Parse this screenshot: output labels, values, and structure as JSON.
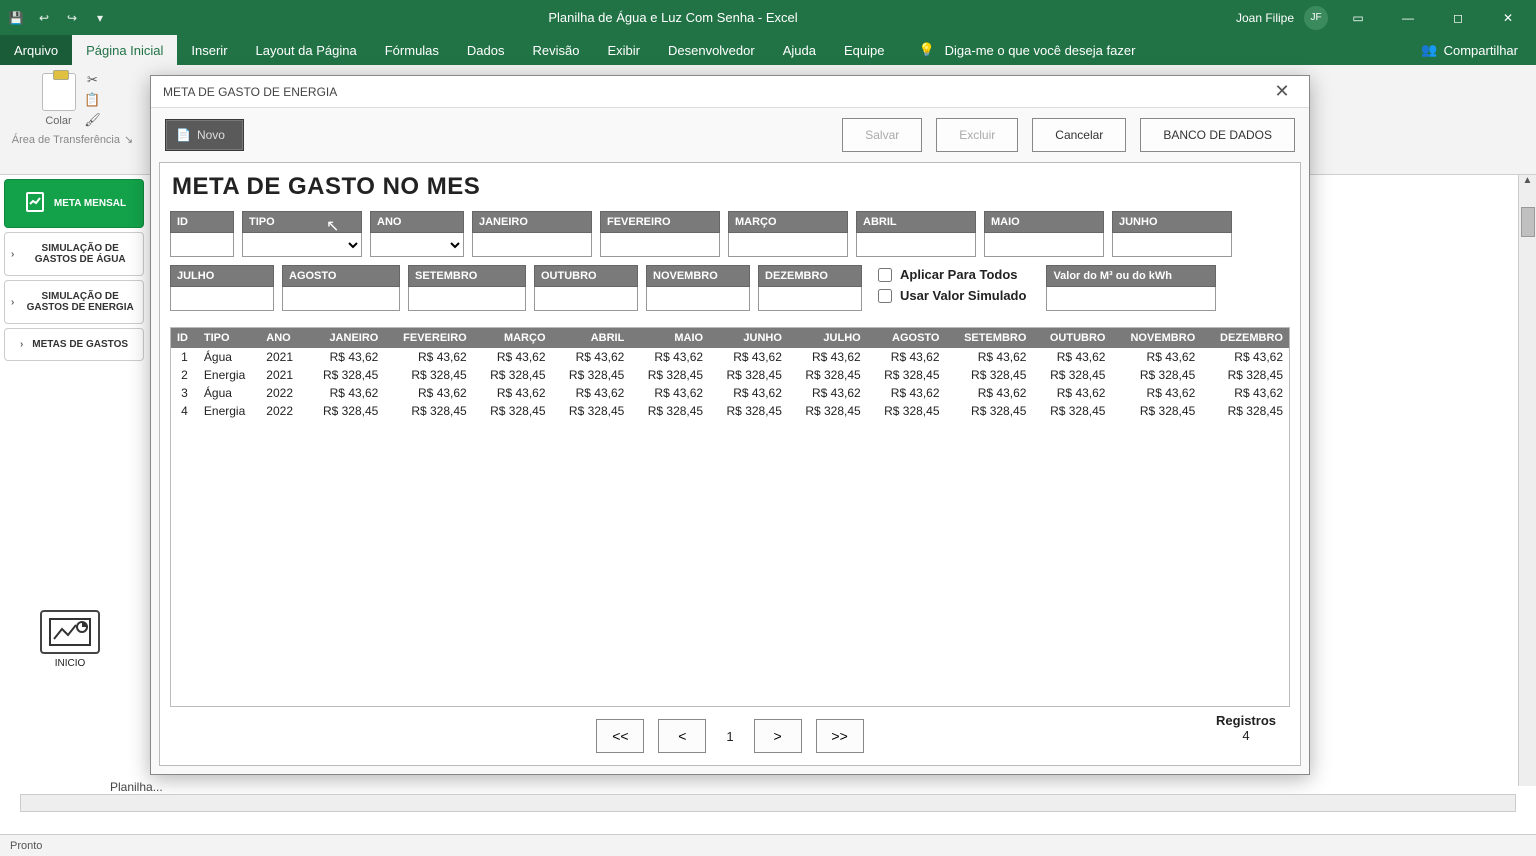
{
  "titlebar": {
    "doc_title": "Planilha de Água e Luz Com Senha  -  Excel",
    "user_name": "Joan Filipe",
    "user_initials": "JF"
  },
  "ribbon": {
    "tabs": [
      "Arquivo",
      "Página Inicial",
      "Inserir",
      "Layout da Página",
      "Fórmulas",
      "Dados",
      "Revisão",
      "Exibir",
      "Desenvolvedor",
      "Ajuda",
      "Equipe"
    ],
    "tell_me": "Diga-me o que você deseja fazer",
    "share": "Compartilhar",
    "paste_label": "Colar",
    "clipboard_group": "Área de Transferência"
  },
  "sidebar": {
    "meta_mensal": "META MENSAL",
    "sim_agua": "SIMULAÇÃO DE GASTOS DE ÁGUA",
    "sim_energia": "SIMULAÇÃO DE GASTOS DE ENERGIA",
    "metas": "METAS DE GASTOS",
    "inicio": "INICIO"
  },
  "dialog": {
    "title": "META DE GASTO DE ENERGIA",
    "novo": "Novo",
    "salvar": "Salvar",
    "excluir": "Excluir",
    "cancelar": "Cancelar",
    "banco": "BANCO DE DADOS",
    "heading": "META DE GASTO NO MES",
    "fields": {
      "id": "ID",
      "tipo": "TIPO",
      "ano": "ANO",
      "jan": "JANEIRO",
      "fev": "FEVEREIRO",
      "mar": "MARÇO",
      "abr": "ABRIL",
      "mai": "MAIO",
      "jun": "JUNHO",
      "jul": "JULHO",
      "ago": "AGOSTO",
      "set": "SETEMBRO",
      "out": "OUTUBRO",
      "nov": "NOVEMBRO",
      "dez": "DEZEMBRO",
      "aplicar": "Aplicar Para Todos",
      "usar_sim": "Usar Valor Simulado",
      "valor": "Valor do M³ ou do kWh"
    },
    "table": {
      "headers": [
        "ID",
        "TIPO",
        "ANO",
        "JANEIRO",
        "FEVEREIRO",
        "MARÇO",
        "ABRIL",
        "MAIO",
        "JUNHO",
        "JULHO",
        "AGOSTO",
        "SETEMBRO",
        "OUTUBRO",
        "NOVEMBRO",
        "DEZEMBRO"
      ],
      "rows": [
        {
          "id": "1",
          "tipo": "Água",
          "ano": "2021",
          "vals": [
            "R$ 43,62",
            "R$ 43,62",
            "R$ 43,62",
            "R$ 43,62",
            "R$ 43,62",
            "R$ 43,62",
            "R$ 43,62",
            "R$ 43,62",
            "R$ 43,62",
            "R$ 43,62",
            "R$ 43,62",
            "R$ 43,62"
          ]
        },
        {
          "id": "2",
          "tipo": "Energia",
          "ano": "2021",
          "vals": [
            "R$ 328,45",
            "R$ 328,45",
            "R$ 328,45",
            "R$ 328,45",
            "R$ 328,45",
            "R$ 328,45",
            "R$ 328,45",
            "R$ 328,45",
            "R$ 328,45",
            "R$ 328,45",
            "R$ 328,45",
            "R$ 328,45"
          ]
        },
        {
          "id": "3",
          "tipo": "Água",
          "ano": "2022",
          "vals": [
            "R$ 43,62",
            "R$ 43,62",
            "R$ 43,62",
            "R$ 43,62",
            "R$ 43,62",
            "R$ 43,62",
            "R$ 43,62",
            "R$ 43,62",
            "R$ 43,62",
            "R$ 43,62",
            "R$ 43,62",
            "R$ 43,62"
          ]
        },
        {
          "id": "4",
          "tipo": "Energia",
          "ano": "2022",
          "vals": [
            "R$ 328,45",
            "R$ 328,45",
            "R$ 328,45",
            "R$ 328,45",
            "R$ 328,45",
            "R$ 328,45",
            "R$ 328,45",
            "R$ 328,45",
            "R$ 328,45",
            "R$ 328,45",
            "R$ 328,45",
            "R$ 328,45"
          ]
        }
      ]
    },
    "pager": {
      "first": "<<",
      "prev": "<",
      "page": "1",
      "next": ">",
      "last": ">>",
      "reg_label": "Registros",
      "reg_count": "4"
    }
  },
  "sheets": {
    "current": "Planilha..."
  },
  "status": {
    "ready": "Pronto"
  }
}
